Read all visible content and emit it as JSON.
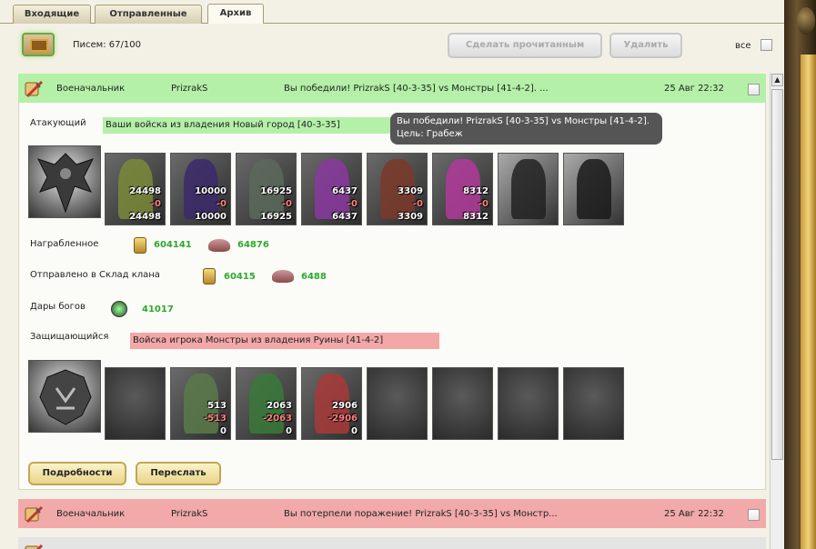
{
  "tabs": [
    {
      "label": "Входящие"
    },
    {
      "label": "Отправленные"
    },
    {
      "label": "Архив"
    }
  ],
  "toolbar": {
    "letters": "Писем: 67/100",
    "mark_read": "Сделать прочитанным",
    "delete": "Удалить",
    "all": "все"
  },
  "messages": [
    {
      "type": "Военачальник",
      "from": "PrizrakS",
      "subject": "Вы победили! PrizrakS [40-3-35] vs Монстры [41-4-2]. ...",
      "date": "25 Авг 22:32"
    },
    {
      "type": "Военачальник",
      "from": "PrizrakS",
      "subject": "Вы потерпели поражение! PrizrakS [40-3-35] vs Монстр...",
      "date": "25 Авг 22:32"
    }
  ],
  "report": {
    "attacker_label": "Атакующий",
    "attacker_bar": "Ваши войска из владения Новый город [40-3-35]",
    "tooltip": "Вы победили! PrizrakS [40-3-35] vs Монстры [41-4-2]. Цель: Грабеж",
    "attacker_units": [
      {
        "a": "24498",
        "b": "-0",
        "c": "24498"
      },
      {
        "a": "10000",
        "b": "-0",
        "c": "10000"
      },
      {
        "a": "16925",
        "b": "-0",
        "c": "16925"
      },
      {
        "a": "6437",
        "b": "-0",
        "c": "6437"
      },
      {
        "a": "3309",
        "b": "-0",
        "c": "3309"
      },
      {
        "a": "8312",
        "b": "-0",
        "c": "8312"
      }
    ],
    "loot_label": "Награбленное",
    "loot_gold": "604141",
    "loot_ore": "64876",
    "clan_label": "Отправлено в Склад клана",
    "clan_gold": "60415",
    "clan_ore": "6488",
    "gods_label": "Дары богов",
    "gods_value": "41017",
    "defender_label": "Защищающийся",
    "defender_bar": "Войска игрока Монстры из владения Руины [41-4-2]",
    "defender_units": [
      {
        "a": "513",
        "b": "-513",
        "c": "0"
      },
      {
        "a": "2063",
        "b": "-2063",
        "c": "0"
      },
      {
        "a": "2906",
        "b": "-2906",
        "c": "0"
      }
    ],
    "details_btn": "Подробности",
    "forward_btn": "Переслать"
  }
}
